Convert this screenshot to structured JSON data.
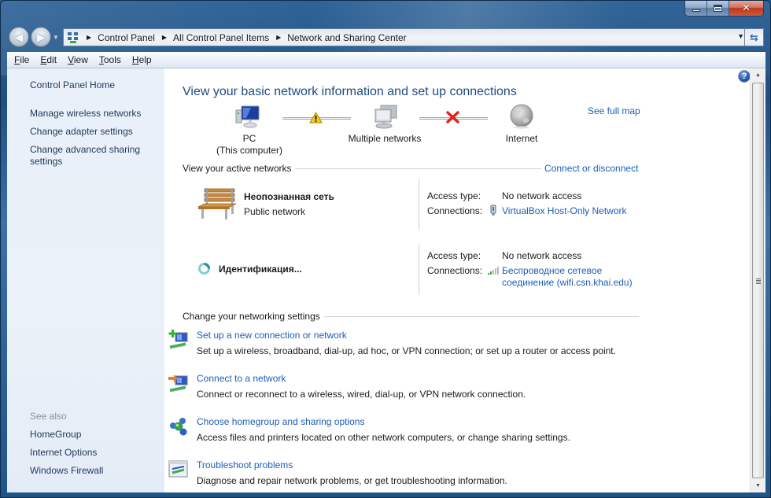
{
  "window": {
    "caption_buttons": {
      "minimize": "minimize-icon",
      "maximize": "maximize-icon",
      "close": "close-icon"
    }
  },
  "navigation": {
    "back_icon": "back-arrow-icon",
    "forward_icon": "forward-arrow-icon",
    "breadcrumbs": [
      "Control Panel",
      "All Control Panel Items",
      "Network and Sharing Center"
    ],
    "refresh_icon": "refresh-icon"
  },
  "menubar": {
    "items": [
      {
        "label": "File",
        "accel": "F",
        "rest": "ile"
      },
      {
        "label": "Edit",
        "accel": "E",
        "rest": "dit"
      },
      {
        "label": "View",
        "accel": "V",
        "rest": "iew"
      },
      {
        "label": "Tools",
        "accel": "T",
        "rest": "ools"
      },
      {
        "label": "Help",
        "accel": "H",
        "rest": "elp"
      }
    ]
  },
  "sidebar": {
    "home": "Control Panel Home",
    "links": [
      "Manage wireless networks",
      "Change adapter settings",
      "Change advanced sharing settings"
    ],
    "see_also_heading": "See also",
    "see_also": [
      "HomeGroup",
      "Internet Options",
      "Windows Firewall"
    ]
  },
  "main": {
    "title": "View your basic network information and set up connections",
    "see_full_map": "See full map",
    "map": {
      "pc": {
        "line1": "PC",
        "line2": "(This computer)"
      },
      "networks": "Multiple networks",
      "internet": "Internet",
      "link1_status": "warning",
      "link2_status": "disconnected"
    },
    "active_networks": {
      "heading": "View your active networks",
      "action": "Connect or disconnect",
      "networks": [
        {
          "name": "Неопознанная сеть",
          "type": "Public network",
          "access_label": "Access type:",
          "access_value": "No network access",
          "connections_label": "Connections:",
          "connection_line1": "VirtualBox Host-Only Network",
          "connection_line2": ""
        },
        {
          "name": "Идентификация...",
          "type": "",
          "access_label": "Access type:",
          "access_value": "No network access",
          "connections_label": "Connections:",
          "connection_line1": "Беспроводное сетевое",
          "connection_line2": "соединение (wifi.csn.khai.edu)"
        }
      ]
    },
    "settings": {
      "heading": "Change your networking settings",
      "tasks": [
        {
          "title": "Set up a new connection or network",
          "desc": "Set up a wireless, broadband, dial-up, ad hoc, or VPN connection; or set up a router or access point."
        },
        {
          "title": "Connect to a network",
          "desc": "Connect or reconnect to a wireless, wired, dial-up, or VPN network connection."
        },
        {
          "title": "Choose homegroup and sharing options",
          "desc": "Access files and printers located on other network computers, or change sharing settings."
        },
        {
          "title": "Troubleshoot problems",
          "desc": "Diagnose and repair network problems, or get troubleshooting information."
        }
      ]
    }
  }
}
